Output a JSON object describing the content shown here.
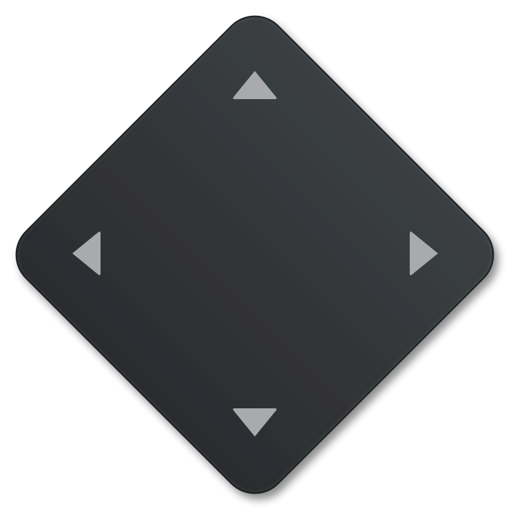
{
  "dpad": {
    "buttons": [
      {
        "id": "up",
        "icon": "up-arrow-icon"
      },
      {
        "id": "left",
        "icon": "left-arrow-icon"
      },
      {
        "id": "right",
        "icon": "right-arrow-icon"
      },
      {
        "id": "down",
        "icon": "down-arrow-icon"
      }
    ],
    "colors": {
      "body_top": "#3b3f42",
      "body_bottom": "#2a2c2e",
      "edge": "#1f2123",
      "arrow": "#a8aaab"
    }
  }
}
